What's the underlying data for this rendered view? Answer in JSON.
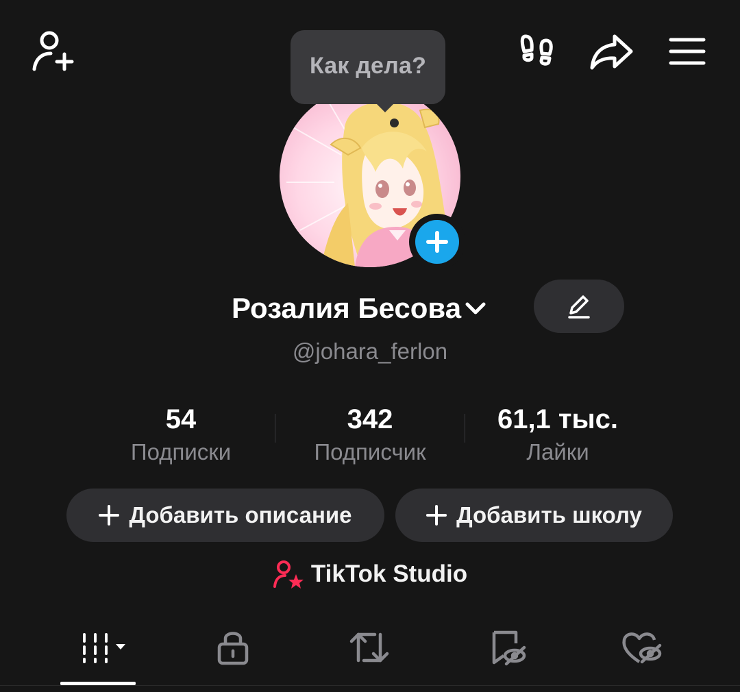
{
  "status_bubble": {
    "text": "Как дела?"
  },
  "profile": {
    "display_name": "Розалия Бесова",
    "username": "@johara_ferlon"
  },
  "stats": [
    {
      "value": "54",
      "label": "Подписки"
    },
    {
      "value": "342",
      "label": "Подписчик"
    },
    {
      "value": "61,1 тыс.",
      "label": "Лайки"
    }
  ],
  "actions": {
    "add_description": "Добавить описание",
    "add_school": "Добавить школу"
  },
  "studio": {
    "label": "TikTok Studio"
  },
  "icons": {
    "top_left": "add-friend-icon",
    "top_right": [
      "footprints-icon",
      "share-icon",
      "menu-icon"
    ],
    "tabs": [
      "videos-grid-icon",
      "lock-icon",
      "repost-icon",
      "bookmark-hidden-icon",
      "heart-hidden-icon"
    ]
  },
  "colors": {
    "background": "#161616",
    "accent_blue": "#1aa7ec",
    "studio_red": "#fe2c55",
    "muted_text": "#8a8a8f",
    "pill_bg": "#2f2f32"
  }
}
